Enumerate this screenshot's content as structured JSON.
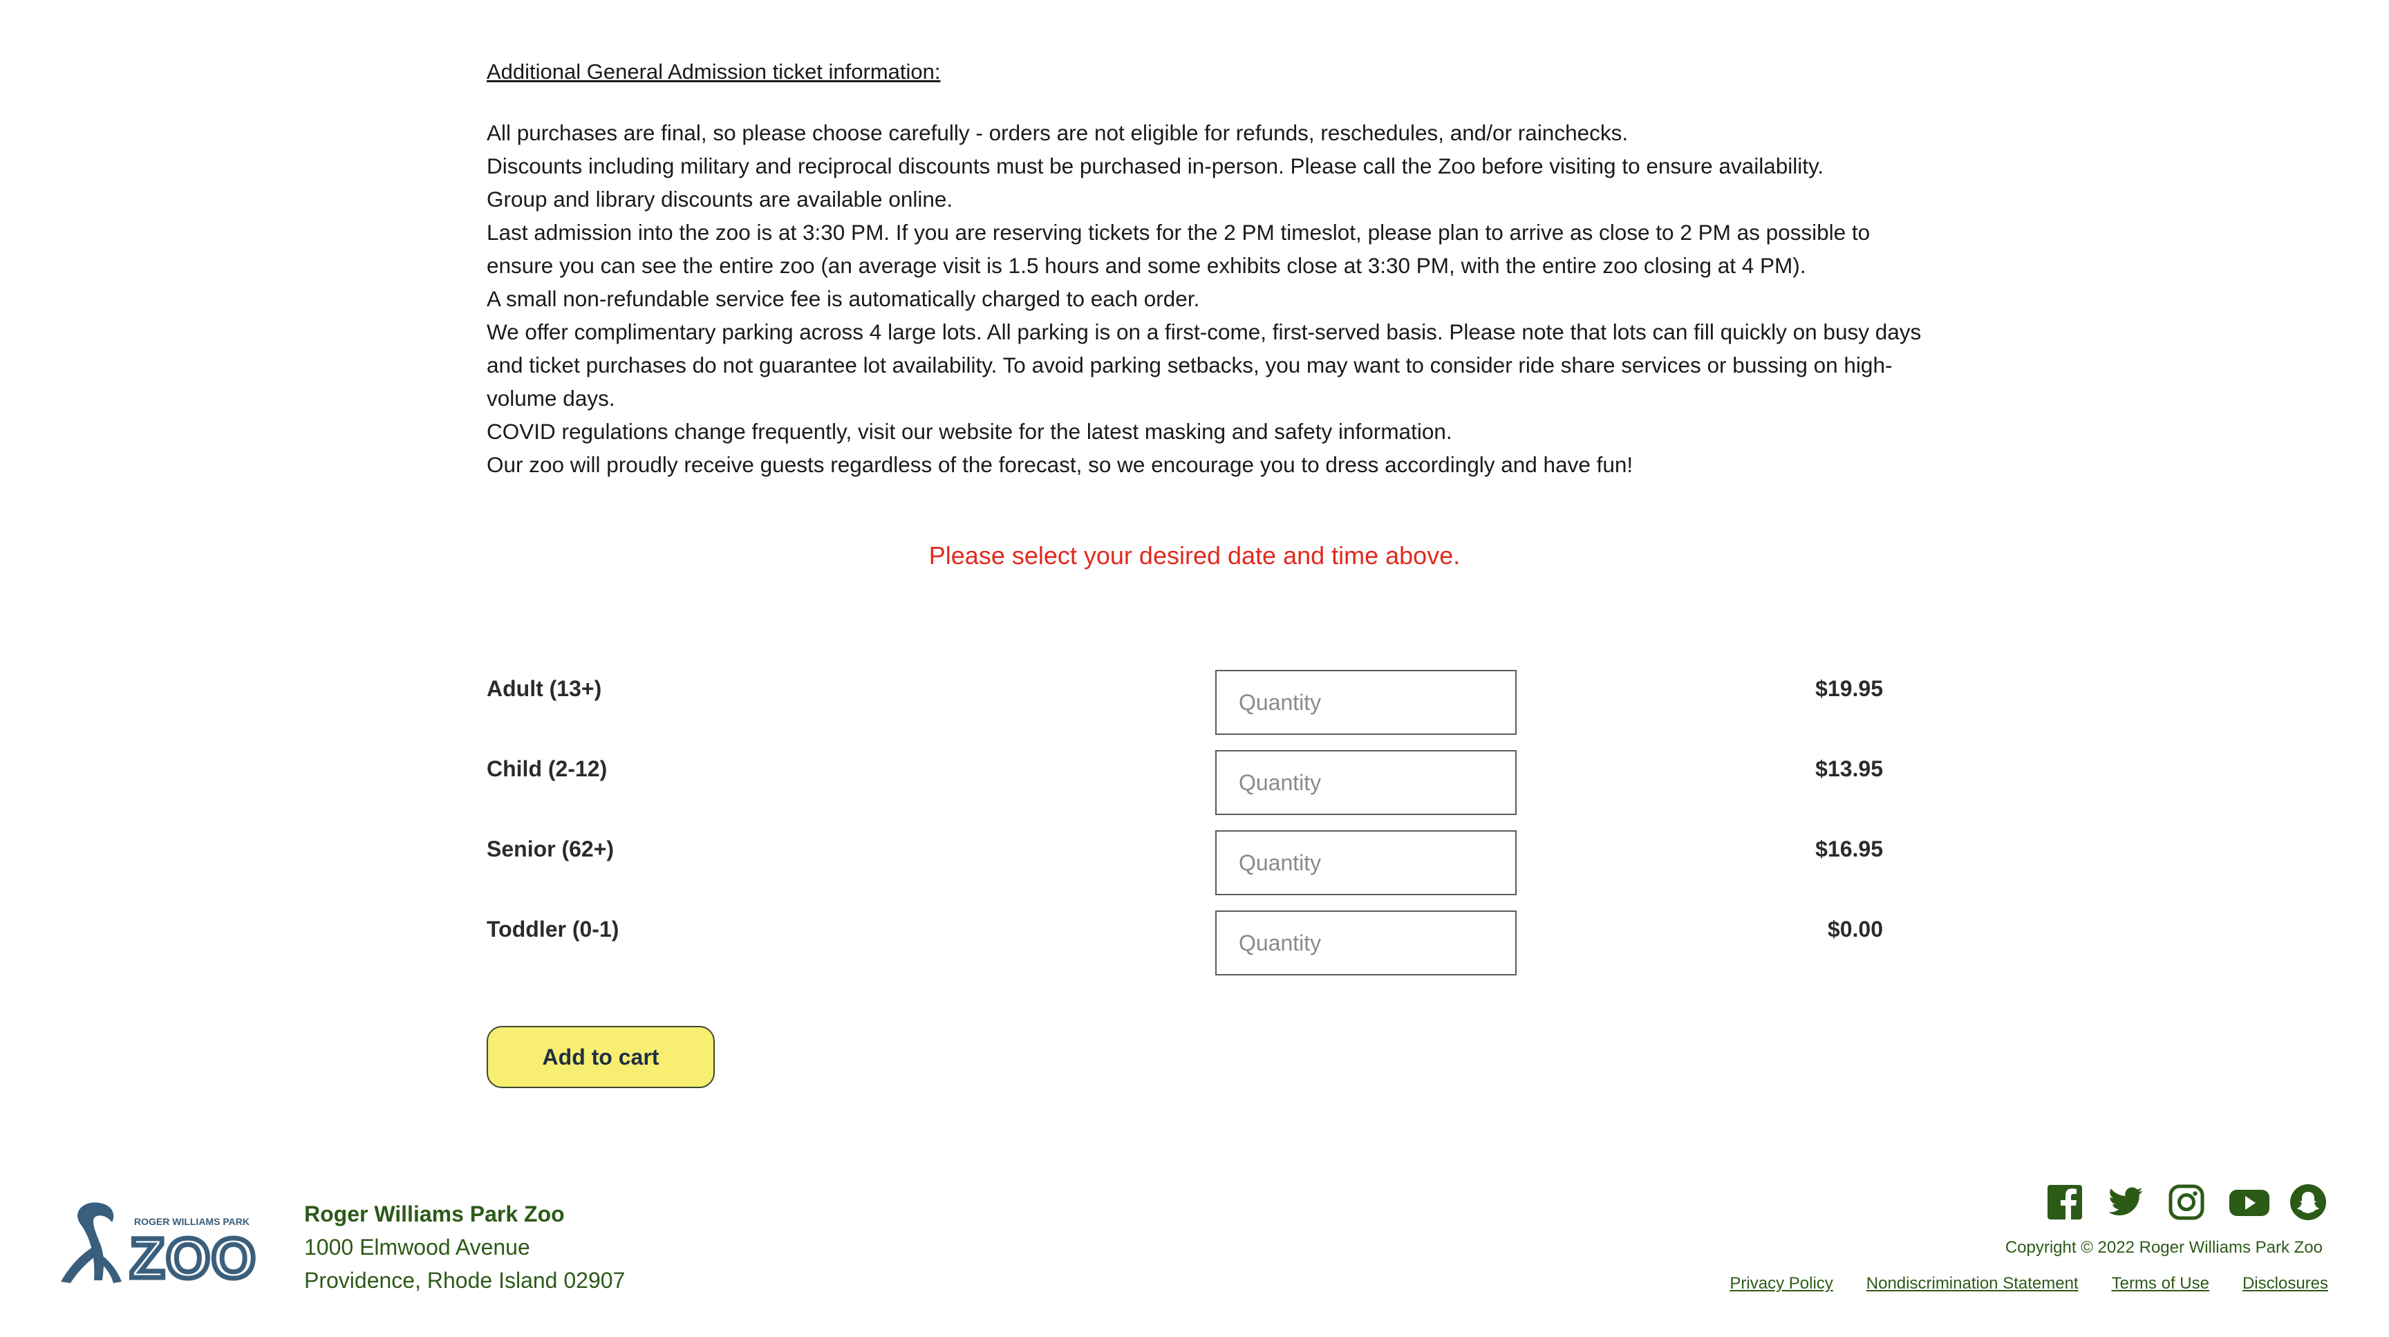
{
  "info": {
    "heading": "Additional General Admission ticket information:",
    "lines": [
      "All purchases are final, so please choose carefully - orders are not eligible for refunds, reschedules, and/or rainchecks.",
      "Discounts including military and reciprocal discounts must be purchased in-person. Please call the Zoo before visiting to ensure availability.",
      "Group and library discounts are available online.",
      "Last admission into the zoo is at 3:30 PM. If you are reserving tickets for the 2 PM timeslot, please plan to arrive as close to 2 PM as possible to ensure you can see the entire zoo (an average visit is 1.5 hours and some exhibits close at 3:30 PM, with the entire zoo closing at 4 PM).",
      "A small non-refundable service fee is automatically charged to each order.",
      "We offer complimentary parking across 4 large lots. All parking is on a first-come, first-served basis.  Please note that lots can fill quickly on busy days and ticket purchases do not guarantee lot availability.  To avoid parking setbacks, you may want to consider ride share services or bussing on high-volume days.",
      "COVID regulations change frequently, visit our website for the latest masking and safety information.",
      "Our zoo will proudly receive guests regardless of the forecast, so we encourage you to dress accordingly and have fun!"
    ]
  },
  "notice": "Please select your desired date and time above.",
  "tickets": [
    {
      "label": "Adult (13+)",
      "placeholder": "Quantity",
      "value": "",
      "price": "$19.95"
    },
    {
      "label": "Child (2-12)",
      "placeholder": "Quantity",
      "value": "",
      "price": "$13.95"
    },
    {
      "label": "Senior (62+)",
      "placeholder": "Quantity",
      "value": "",
      "price": "$16.95"
    },
    {
      "label": "Toddler (0-1)",
      "placeholder": "Quantity",
      "value": "",
      "price": "$0.00"
    }
  ],
  "add_to_cart_label": "Add to cart",
  "footer": {
    "logo_small_text": "ROGER WILLIAMS PARK",
    "logo_text": "ZOO",
    "name": "Roger Williams Park Zoo",
    "street": "1000 Elmwood Avenue",
    "city": "Providence, Rhode Island 02907",
    "social_icons": [
      "facebook-icon",
      "twitter-icon",
      "instagram-icon",
      "youtube-icon",
      "snapchat-icon"
    ],
    "copyright": "Copyright © 2022 Roger Williams Park Zoo",
    "links": [
      "Privacy Policy",
      "Nondiscrimination Statement",
      "Terms of Use",
      "Disclosures"
    ]
  },
  "colors": {
    "notice": "#e02a1f",
    "footer_green": "#2c5a17",
    "button_fill": "#f7ee72",
    "logo_blue": "#3a5f7d"
  }
}
